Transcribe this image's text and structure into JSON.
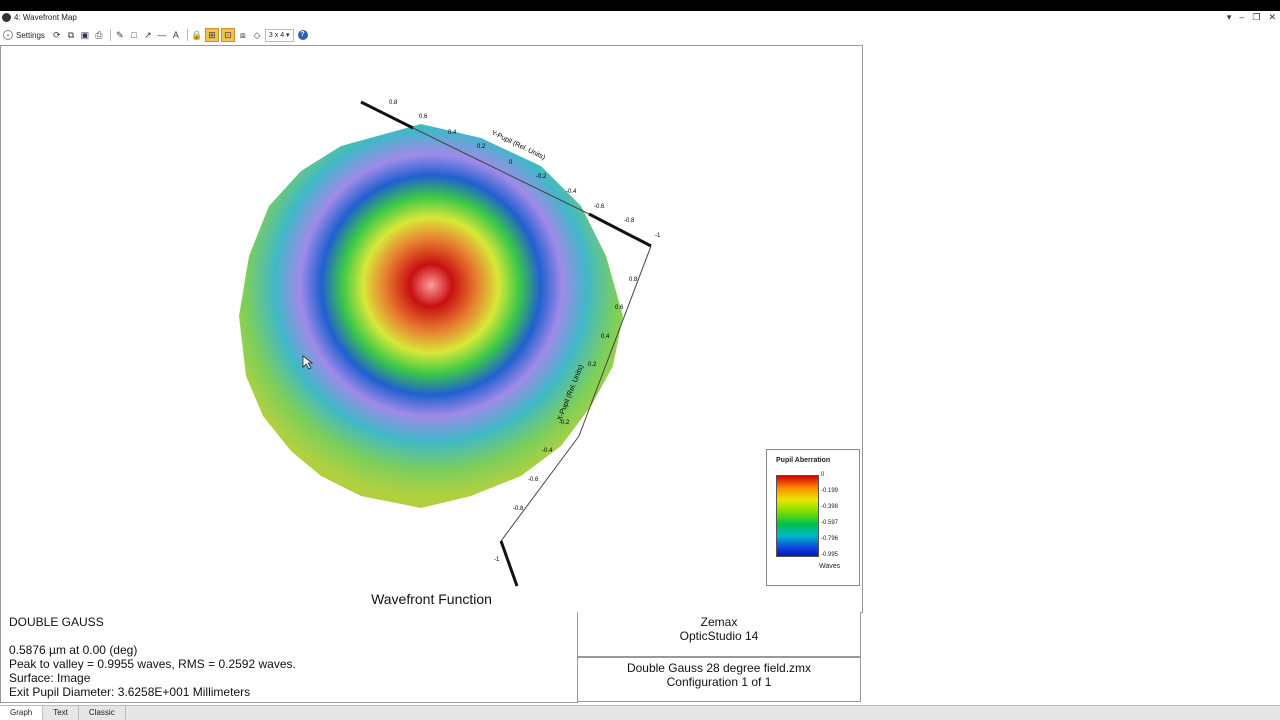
{
  "window": {
    "title": "4: Wavefront Map"
  },
  "toolbar": {
    "settings_label": "Settings",
    "layout_value": "3 x 4"
  },
  "plot": {
    "y_axis_label": "Y-Pupil (Rel. Units)",
    "x_axis_label": "X-Pupil (Rel. Units)",
    "y_ticks": [
      "0.8",
      "0.6",
      "0.4",
      "0.2",
      "0",
      "-0.2",
      "-0.4",
      "-0.6",
      "-0.8",
      "-1"
    ],
    "x_ticks": [
      "0.8",
      "0.6",
      "0.4",
      "0.2",
      "-0.2",
      "-0.4",
      "-0.6",
      "-0.8",
      "-1"
    ]
  },
  "legend": {
    "title": "Pupil Aberration",
    "ticks": [
      "0",
      "-0.199",
      "-0.398",
      "-0.597",
      "-0.796",
      "-0.995"
    ],
    "unit": "Waves"
  },
  "caption": "Wavefront Function",
  "info": {
    "line1": "DOUBLE GAUSS",
    "line2": "0.5876 µm at 0.00 (deg)",
    "line3": "Peak to valley = 0.9955 waves, RMS = 0.2592 waves.",
    "line4": "Surface: Image",
    "line5": "Exit Pupil Diameter: 3.6258E+001 Millimeters"
  },
  "side": {
    "company": "Zemax",
    "product": "OpticStudio 14",
    "file": "Double Gauss 28 degree field.zmx",
    "config": "Configuration 1 of 1"
  },
  "tabs": [
    {
      "label": "Graph"
    },
    {
      "label": "Text"
    },
    {
      "label": "Classic"
    }
  ]
}
